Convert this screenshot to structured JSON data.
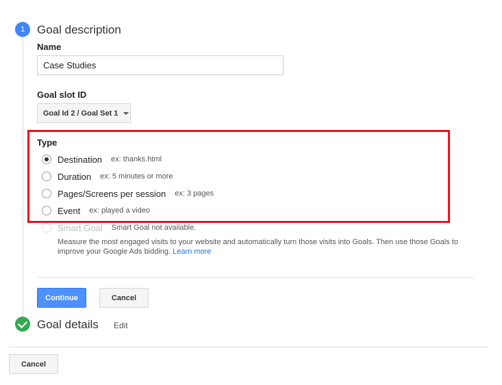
{
  "step1": {
    "number": "1",
    "title": "Goal description",
    "name_label": "Name",
    "name_value": "Case Studies",
    "slot_label": "Goal slot ID",
    "slot_value": "Goal Id 2 / Goal Set 1",
    "type_label": "Type",
    "options": [
      {
        "label": "Destination",
        "hint": "ex: thanks.html",
        "checked": true
      },
      {
        "label": "Duration",
        "hint": "ex: 5 minutes or more",
        "checked": false
      },
      {
        "label": "Pages/Screens per session",
        "hint": "ex: 3 pages",
        "checked": false
      },
      {
        "label": "Event",
        "hint": "ex: played a video",
        "checked": false
      }
    ],
    "smart_goal": {
      "label": "Smart Goal",
      "hint": "Smart Goal not available.",
      "description": "Measure the most engaged visits to your website and automatically turn those visits into Goals. Then use those Goals to improve your Google Ads bidding.",
      "learn_more": "Learn more"
    },
    "continue_label": "Continue",
    "cancel_label": "Cancel"
  },
  "step2": {
    "title": "Goal details",
    "edit_label": "Edit"
  },
  "footer": {
    "cancel_label": "Cancel"
  },
  "colors": {
    "step_active": "#4285f4",
    "step_done": "#34a853",
    "highlight": "#e8131e",
    "primary_button": "#4d90fe",
    "link": "#1a73e8"
  },
  "icons": {
    "step2": "checkmark-icon",
    "slot_dropdown": "caret-down-icon"
  }
}
